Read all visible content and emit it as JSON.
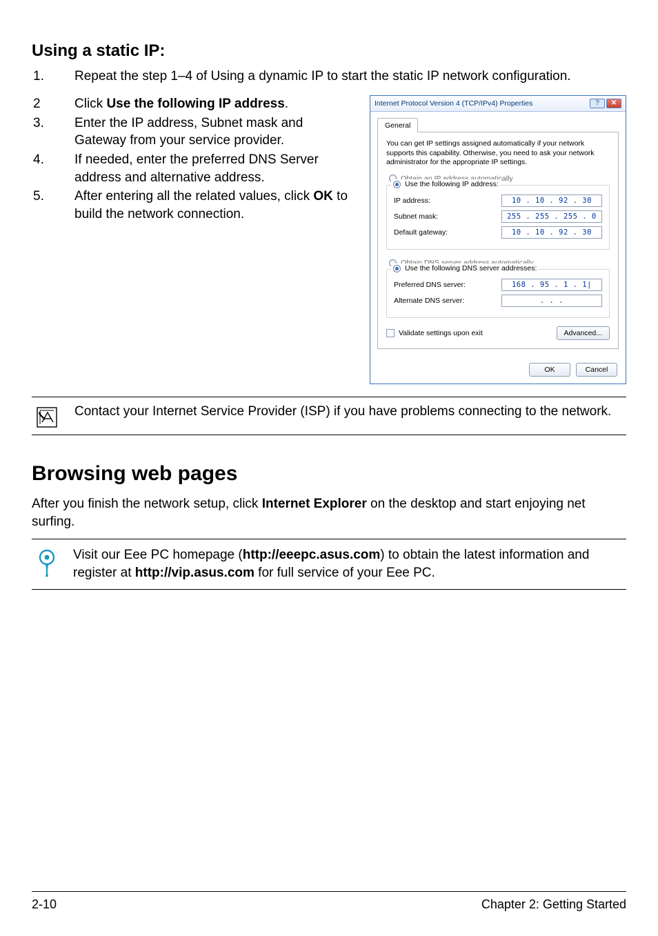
{
  "headings": {
    "static_ip": "Using a static IP:",
    "browsing": "Browsing web pages"
  },
  "steps_top": {
    "s1_num": "1.",
    "s1_txt": "Repeat the step 1–4 of Using a dynamic IP to start the static IP network configuration."
  },
  "steps_left": {
    "s2_num": "2",
    "s2_pre": "Click ",
    "s2_bold": "Use the following IP address",
    "s2_post": ".",
    "s3_num": "3.",
    "s3_txt": "Enter the IP address, Subnet mask and Gateway from your service provider.",
    "s4_num": "4.",
    "s4_txt": "If needed, enter the preferred DNS Server address and alternative address.",
    "s5_num": "5.",
    "s5_pre": "After entering all the related values, click ",
    "s5_bold": "OK",
    "s5_post": " to build the network connection."
  },
  "dialog": {
    "title": "Internet Protocol Version 4 (TCP/IPv4) Properties",
    "tab": "General",
    "desc": "You can get IP settings assigned automatically if your network supports this capability. Otherwise, you need to ask your network administrator for the appropriate IP settings.",
    "r_obtain_ip": "Obtain an IP address automatically",
    "r_use_ip": "Use the following IP address:",
    "ip_address_lbl": "IP address:",
    "ip_address_val": "10 . 10 . 92 . 30",
    "subnet_lbl": "Subnet mask:",
    "subnet_val": "255 . 255 . 255 .  0",
    "gateway_lbl": "Default gateway:",
    "gateway_val": "10 . 10 . 92 . 30",
    "r_obtain_dns": "Obtain DNS server address automatically",
    "r_use_dns": "Use the following DNS server addresses:",
    "pref_dns_lbl": "Preferred DNS server:",
    "pref_dns_val": "168 . 95 .  1 .  1|",
    "alt_dns_lbl": "Alternate DNS server:",
    "alt_dns_val": ".      .      .",
    "validate": "Validate settings upon exit",
    "advanced": "Advanced...",
    "ok": "OK",
    "cancel": "Cancel",
    "help_glyph": "?",
    "close_glyph": "✕"
  },
  "callout_isp": "Contact your Internet Service Provider (ISP) if you have problems connecting to the network.",
  "browsing_para_pre": "After you finish the network setup, click ",
  "browsing_para_bold": "Internet Explorer",
  "browsing_para_post": " on the desktop and start enjoying net surfing.",
  "tip": {
    "pre": "Visit our Eee PC homepage (",
    "url1": "http://eeepc.asus.com",
    "mid": ") to obtain the latest information and register at ",
    "url2": "http://vip.asus.com",
    "post": " for full service of your Eee PC."
  },
  "footer": {
    "left": "2-10",
    "right": "Chapter 2: Getting Started"
  }
}
